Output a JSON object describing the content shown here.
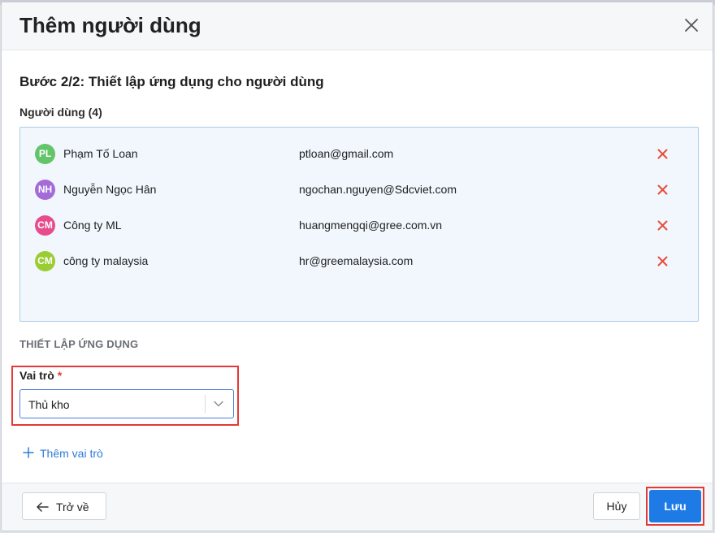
{
  "dialog": {
    "title": "Thêm người dùng",
    "step_title": "Bước 2/2: Thiết lập ứng dụng cho người dùng",
    "users_label": "Người dùng (4)"
  },
  "users": [
    {
      "initials": "PL",
      "name": "Phạm Tố Loan",
      "email": "ptloan@gmail.com",
      "color": "#63c46a"
    },
    {
      "initials": "NH",
      "name": "Nguyễn Ngọc Hân",
      "email": "ngochan.nguyen@Sdcviet.com",
      "color": "#a36bd8"
    },
    {
      "initials": "CM",
      "name": "Công ty ML",
      "email": "huangmengqi@gree.com.vn",
      "color": "#e74c8c"
    },
    {
      "initials": "CM",
      "name": "công ty malaysia",
      "email": "hr@greemalaysia.com",
      "color": "#9acd32"
    }
  ],
  "app_setup": {
    "section_label": "THIẾT LẬP ỨNG DỤNG",
    "role_label": "Vai trò",
    "required_mark": "*",
    "role_value": "Thủ kho",
    "add_role_label": "Thêm vai trò"
  },
  "footer": {
    "back_label": "Trở về",
    "cancel_label": "Hủy",
    "save_label": "Lưu"
  },
  "colors": {
    "accent": "#1e7be6",
    "remove_icon": "#e74c3c",
    "highlight": "#e53935"
  }
}
